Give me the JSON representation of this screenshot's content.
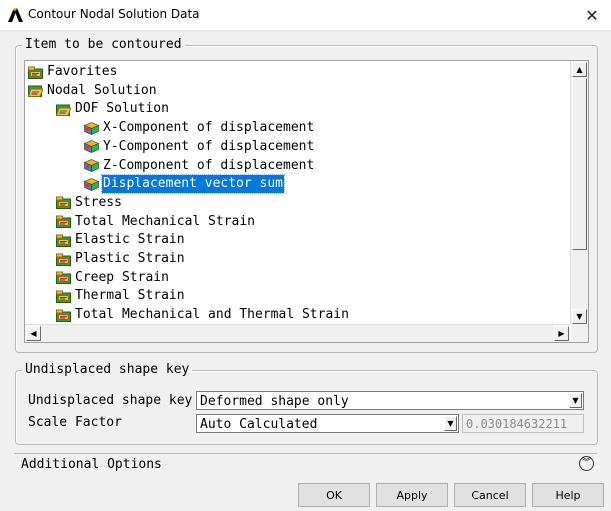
{
  "window": {
    "title": "Contour Nodal Solution Data",
    "close_glyph": "✕"
  },
  "item_group": {
    "legend": "Item to be contoured",
    "tree": [
      {
        "label": "Favorites",
        "depth": 0,
        "icon": "folder-closed-icon",
        "selected": false
      },
      {
        "label": "Nodal Solution",
        "depth": 0,
        "icon": "folder-open-icon",
        "selected": false
      },
      {
        "label": "DOF Solution",
        "depth": 1,
        "icon": "folder-open-icon",
        "selected": false
      },
      {
        "label": "X-Component of displacement",
        "depth": 2,
        "icon": "cube-icon",
        "selected": false
      },
      {
        "label": "Y-Component of displacement",
        "depth": 2,
        "icon": "cube-icon",
        "selected": false
      },
      {
        "label": "Z-Component of displacement",
        "depth": 2,
        "icon": "cube-icon",
        "selected": false
      },
      {
        "label": "Displacement vector sum",
        "depth": 2,
        "icon": "cube-icon",
        "selected": true
      },
      {
        "label": "Stress",
        "depth": 1,
        "icon": "folder-closed-icon",
        "selected": false
      },
      {
        "label": "Total Mechanical Strain",
        "depth": 1,
        "icon": "folder-closed-icon",
        "selected": false
      },
      {
        "label": "Elastic Strain",
        "depth": 1,
        "icon": "folder-closed-icon",
        "selected": false
      },
      {
        "label": "Plastic Strain",
        "depth": 1,
        "icon": "folder-closed-icon",
        "selected": false
      },
      {
        "label": "Creep Strain",
        "depth": 1,
        "icon": "folder-closed-icon",
        "selected": false
      },
      {
        "label": "Thermal Strain",
        "depth": 1,
        "icon": "folder-closed-icon",
        "selected": false
      },
      {
        "label": "Total Mechanical and Thermal Strain",
        "depth": 1,
        "icon": "folder-closed-icon",
        "selected": false
      }
    ]
  },
  "undisplaced_group": {
    "legend": "Undisplaced shape key",
    "shape_key_label": "Undisplaced shape key",
    "shape_key_value": "Deformed shape only",
    "scale_factor_label": "Scale Factor",
    "scale_factor_mode": "Auto Calculated",
    "scale_factor_value": "0.030184632211"
  },
  "additional_options": {
    "label": "Additional Options"
  },
  "buttons": {
    "ok": "OK",
    "apply": "Apply",
    "cancel": "Cancel",
    "help": "Help"
  },
  "colors": {
    "selection": "#0078d7",
    "folder": "#3c9a3c",
    "title_icon": "#000000"
  }
}
